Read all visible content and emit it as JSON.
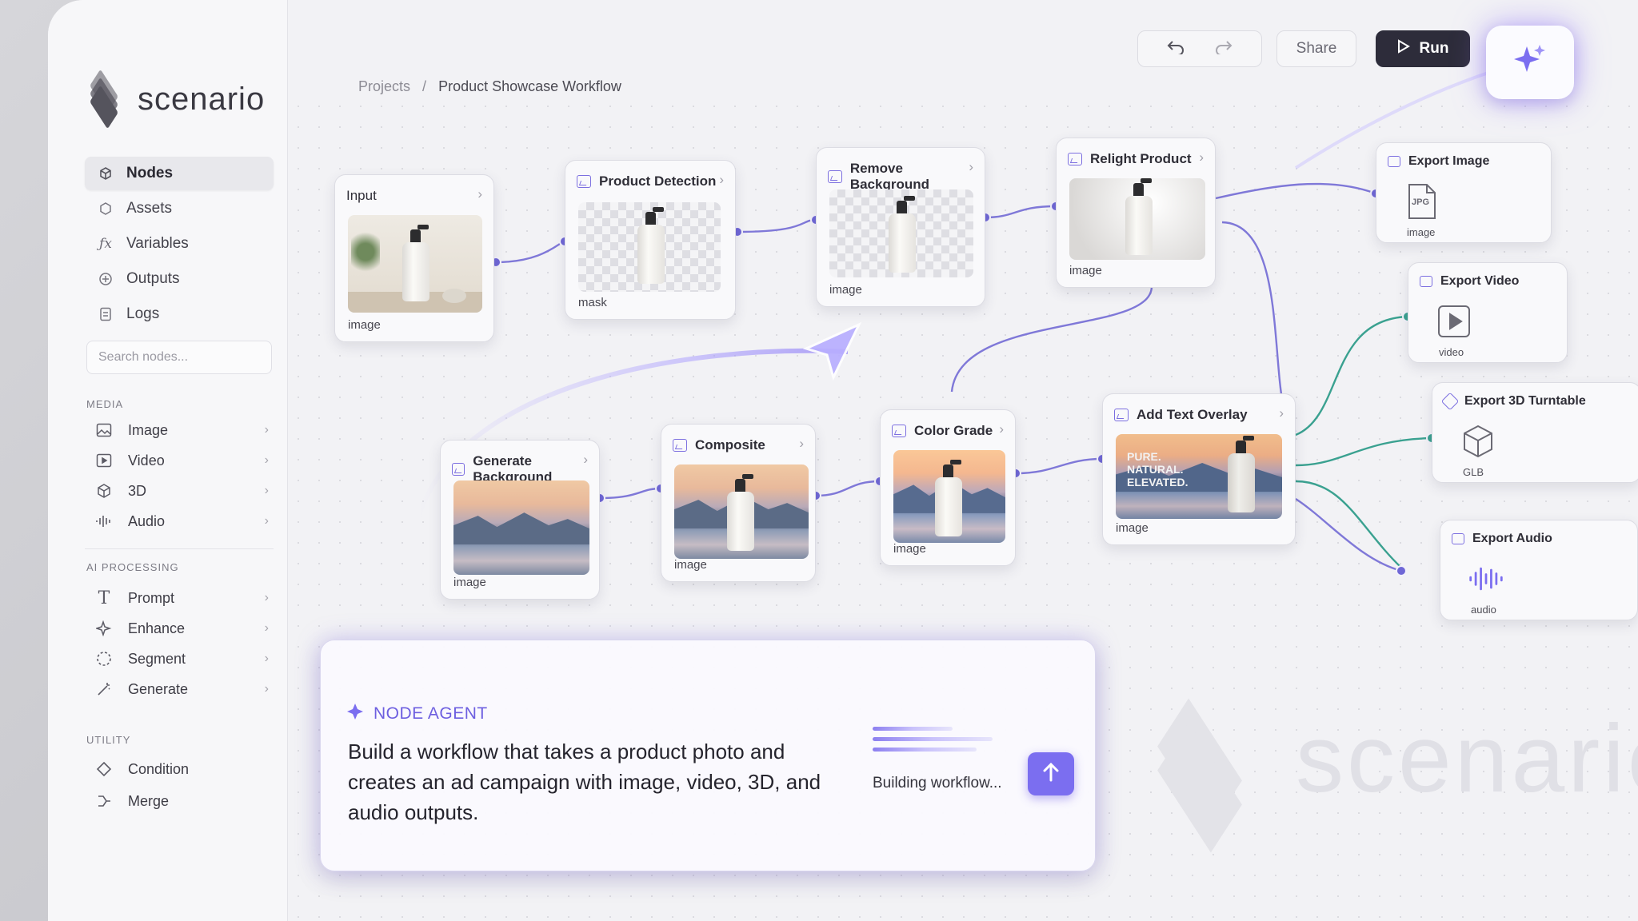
{
  "brand": {
    "name": "scenario"
  },
  "breadcrumb": {
    "root": "Projects",
    "separator": "/",
    "current": "Product Showcase Workflow"
  },
  "toolbar": {
    "share_label": "Share",
    "run_label": "Run"
  },
  "sidebar": {
    "nav": [
      {
        "label": "Nodes",
        "icon": "box-icon"
      },
      {
        "label": "Assets",
        "icon": "cube-icon"
      },
      {
        "label": "Variables",
        "icon": "variable-icon"
      },
      {
        "label": "Outputs",
        "icon": "plus-circle-icon"
      },
      {
        "label": "Logs",
        "icon": "document-icon"
      }
    ],
    "search_placeholder": "Search nodes...",
    "media_label": "MEDIA",
    "media": [
      {
        "label": "Image",
        "icon": "image-icon"
      },
      {
        "label": "Video",
        "icon": "video-icon"
      },
      {
        "label": "3D",
        "icon": "cube-3d-icon"
      },
      {
        "label": "Audio",
        "icon": "audio-wave-icon"
      }
    ],
    "ai_label": "AI PROCESSING",
    "ai": [
      {
        "label": "Prompt",
        "icon": "text-icon"
      },
      {
        "label": "Enhance",
        "icon": "sparkle-icon"
      },
      {
        "label": "Segment",
        "icon": "dashed-circle-icon"
      },
      {
        "label": "Generate",
        "icon": "wand-icon"
      }
    ],
    "utility_label": "UTILITY",
    "utility": [
      {
        "label": "Condition",
        "icon": "diamond-icon"
      },
      {
        "label": "Merge",
        "icon": "merge-icon"
      }
    ]
  },
  "nodes": {
    "input": {
      "title": "Input",
      "output": "image"
    },
    "product_detection": {
      "title": "Product Detection",
      "output": "mask"
    },
    "remove_background": {
      "title": "Remove Background",
      "output": "image"
    },
    "relight_product": {
      "title": "Relight Product",
      "output": "image"
    },
    "generate_background": {
      "title": "Generate Background",
      "output": "image"
    },
    "composite": {
      "title": "Composite",
      "output": "image"
    },
    "color_grade": {
      "title": "Color Grade",
      "output": "image"
    },
    "add_text_overlay": {
      "title": "Add Text Overlay",
      "output": "image",
      "overlay_text": [
        "PURE.",
        "NATURAL.",
        "ELEVATED."
      ]
    }
  },
  "exports": {
    "image": {
      "title": "Export Image",
      "badge": "JPG",
      "output": "image"
    },
    "video": {
      "title": "Export Video",
      "output": "video"
    },
    "turntable": {
      "title": "Export 3D Turntable",
      "output": "GLB"
    },
    "audio": {
      "title": "Export Audio",
      "output": "audio"
    }
  },
  "agent": {
    "tag": "NODE AGENT",
    "message": "Build a workflow that takes a product photo and creates an ad campaign with image, video, 3D, and audio outputs.",
    "status": "Building workflow..."
  },
  "watermark": "scenario",
  "colors": {
    "accent": "#7b6ef0",
    "accent_dark": "#6d5fe0",
    "run_bg": "#2d2c3a",
    "wire_purple": "#7f78d8",
    "wire_teal": "#3aa190"
  }
}
